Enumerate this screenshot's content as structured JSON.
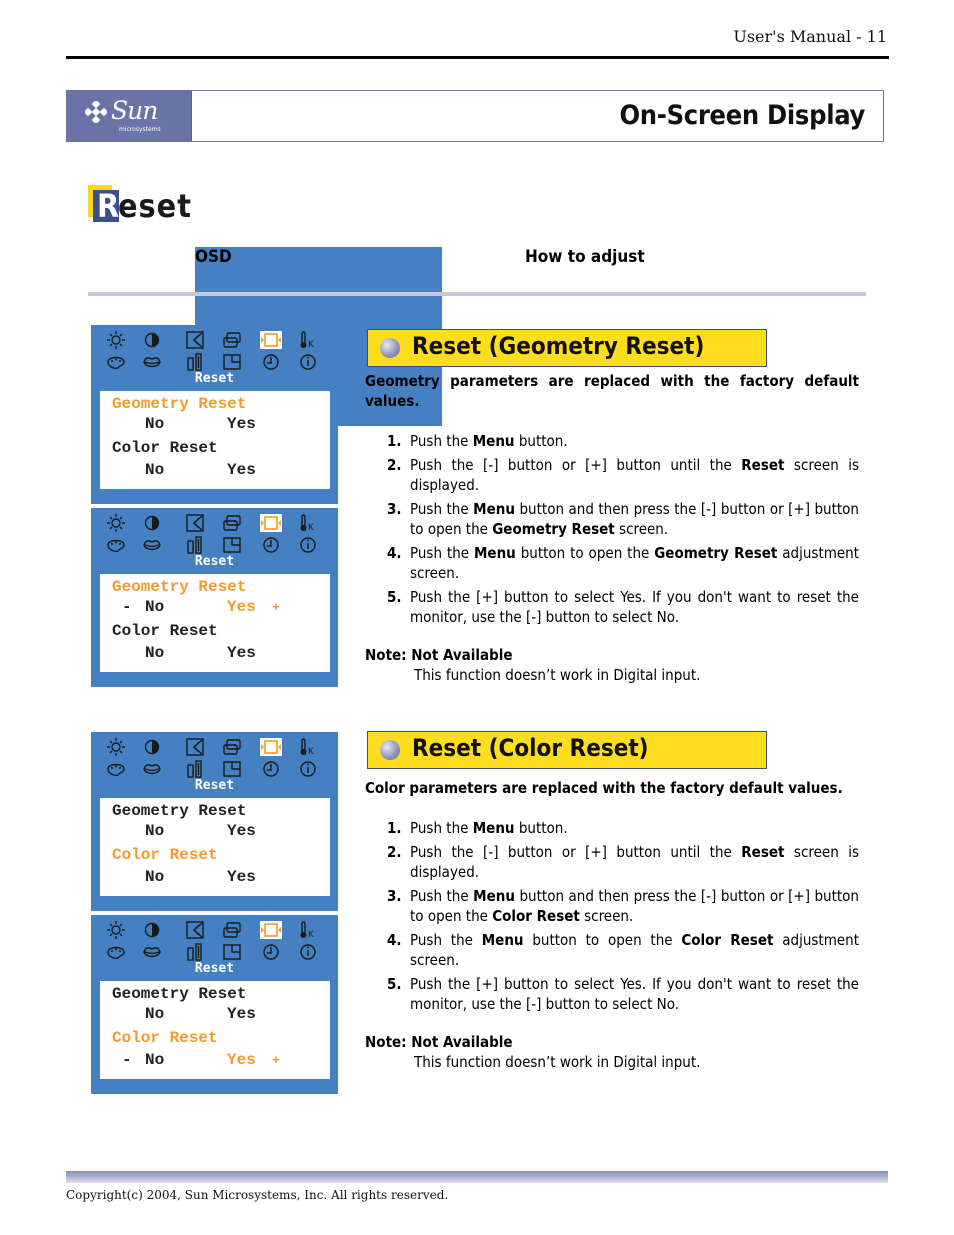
{
  "header": {
    "page_label": "User's Manual - 11",
    "banner_title": "On-Screen Display",
    "logo": {
      "word": "Sun",
      "sub": "microsystems",
      "icon": "sun-logo-icon"
    }
  },
  "page": {
    "heading_initial": "R",
    "heading_rest": "eset",
    "columns": {
      "osd": "OSD",
      "how": "How to adjust"
    }
  },
  "osd_icons": [
    "brightness-icon",
    "contrast-icon",
    "position-icon",
    "size-icon",
    "reset-icon",
    "color-temp-icon",
    "color-palette-icon",
    "lips-icon",
    "moire-icon",
    "osd-position-icon",
    "timer-icon",
    "info-icon"
  ],
  "osd_screens": [
    {
      "title": "Reset",
      "geometry_label": "Geometry Reset",
      "color_label": "Color Reset",
      "no": "No",
      "yes": "Yes",
      "minus": "-",
      "plus": "+",
      "highlight": "geometry",
      "selected_option": "none"
    },
    {
      "title": "Reset",
      "geometry_label": "Geometry Reset",
      "color_label": "Color Reset",
      "no": "No",
      "yes": "Yes",
      "minus": "-",
      "plus": "+",
      "highlight": "geometry",
      "selected_option": "geometry-yes"
    },
    {
      "title": "Reset",
      "geometry_label": "Geometry Reset",
      "color_label": "Color Reset",
      "no": "No",
      "yes": "Yes",
      "minus": "-",
      "plus": "+",
      "highlight": "color",
      "selected_option": "none"
    },
    {
      "title": "Reset",
      "geometry_label": "Geometry Reset",
      "color_label": "Color Reset",
      "no": "No",
      "yes": "Yes",
      "minus": "-",
      "plus": "+",
      "highlight": "color",
      "selected_option": "color-yes"
    }
  ],
  "sections": [
    {
      "title": "Reset (Geometry Reset)",
      "lead": "Geometry parameters are replaced with the factory default values.",
      "steps": [
        {
          "num": "1.",
          "parts": [
            "Push the ",
            "Menu",
            " button."
          ]
        },
        {
          "num": "2.",
          "parts": [
            "Push the [-] button or [+] button until the ",
            "Reset",
            " screen is displayed."
          ]
        },
        {
          "num": "3.",
          "parts": [
            "Push the ",
            "Menu",
            " button and then press the [-] button or [+] button to open the ",
            "Geometry Reset",
            " screen."
          ]
        },
        {
          "num": "4.",
          "parts": [
            "Push the ",
            "Menu",
            " button to open the ",
            "Geometry Reset",
            " adjustment screen."
          ]
        },
        {
          "num": "5.",
          "parts": [
            "Push the [+] button to select Yes.  If you don't want to reset the monitor, use the [-] button to select No."
          ]
        }
      ],
      "note_label": "Note: Not Available",
      "note_text": "This function doesn’t work in Digital input."
    },
    {
      "title": "Reset (Color Reset)",
      "lead": "Color parameters are replaced with the factory default values.",
      "steps": [
        {
          "num": "1.",
          "parts": [
            "Push the ",
            "Menu",
            " button."
          ]
        },
        {
          "num": "2.",
          "parts": [
            "Push the [-] button or [+] button until the ",
            "Reset",
            " screen is displayed."
          ]
        },
        {
          "num": "3.",
          "parts": [
            "Push the ",
            "Menu",
            " button and then press the [-] button or [+] button to open the ",
            "Color Reset",
            " screen."
          ]
        },
        {
          "num": "4.",
          "parts": [
            "Push the ",
            "Menu",
            " button to open the ",
            "Color Reset",
            " adjustment screen."
          ]
        },
        {
          "num": "5.",
          "parts": [
            "Push the [+] button to select Yes.  If you don't want to reset the monitor, use the [-] button to select No."
          ]
        }
      ],
      "note_label": "Note: Not Available",
      "note_text": "This function doesn’t work in Digital input."
    }
  ],
  "footer": {
    "copyright": "Copyright(c) 2004, Sun Microsystems, Inc. All rights reserved."
  },
  "colors": {
    "osd_bg": "#4480c2",
    "highlight": "#f39a2c",
    "section_title_bg": "#fedd1f",
    "banner_logo_bg": "#6b74a6"
  }
}
